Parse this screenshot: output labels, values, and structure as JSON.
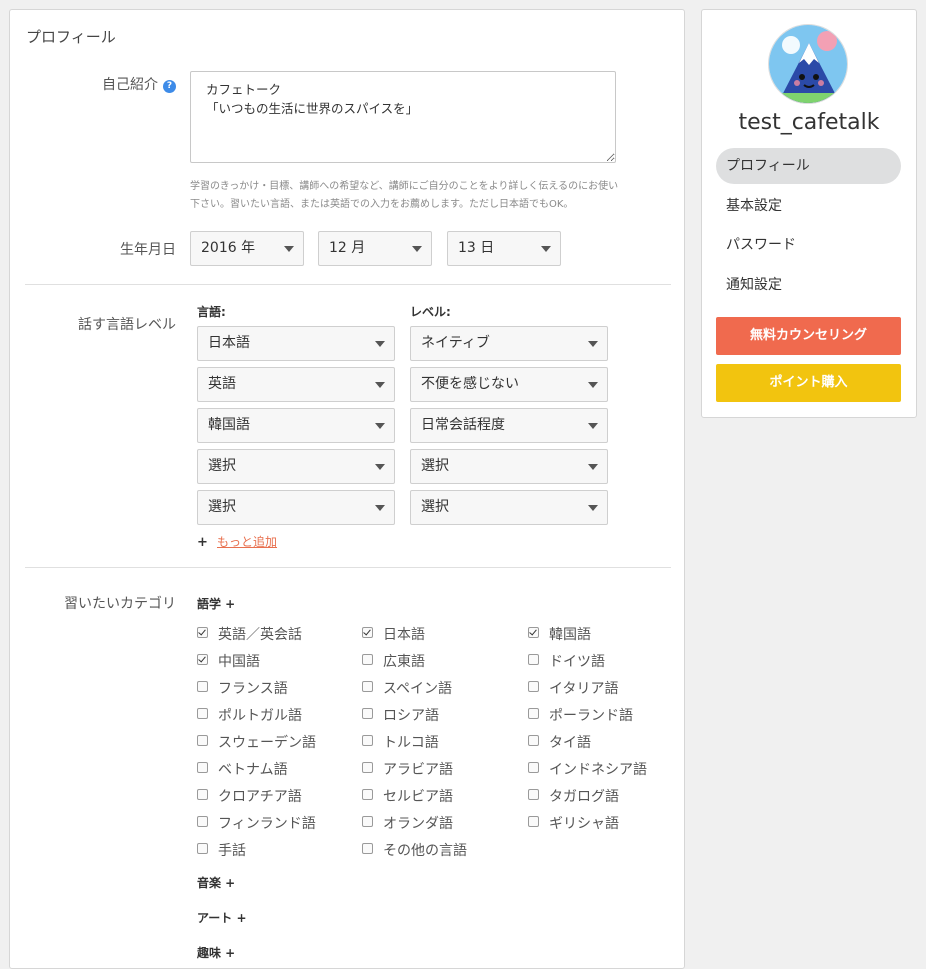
{
  "page_title": "プロフィール",
  "bio": {
    "label": "自己紹介",
    "value": "カフェトーク\n「いつもの生活に世界のスパイスを」",
    "hint": "学習のきっかけ・目標、講師への希望など、講師にご自分のことをより詳しく伝えるのにお使い下さい。習いたい言語、または英語での入力をお薦めします。ただし日本語でもOK。"
  },
  "birthday": {
    "label": "生年月日",
    "year": "2016 年",
    "month": "12 月",
    "day": "13 日"
  },
  "languages": {
    "label": "話す言語レベル",
    "col_language": "言語:",
    "col_level": "レベル:",
    "rows": [
      {
        "language": "日本語",
        "level": "ネイティブ"
      },
      {
        "language": "英語",
        "level": "不便を感じない"
      },
      {
        "language": "韓国語",
        "level": "日常会話程度"
      },
      {
        "language": "選択",
        "level": "選択"
      },
      {
        "language": "選択",
        "level": "選択"
      }
    ],
    "add_plus": "+",
    "add_more": "もっと追加"
  },
  "categories": {
    "label": "習いたいカテゴリ",
    "group_language": "語学 +",
    "items": [
      {
        "name": "英語／英会話",
        "checked": true
      },
      {
        "name": "日本語",
        "checked": true
      },
      {
        "name": "韓国語",
        "checked": true
      },
      {
        "name": "中国語",
        "checked": true
      },
      {
        "name": "広東語",
        "checked": false
      },
      {
        "name": "ドイツ語",
        "checked": false
      },
      {
        "name": "フランス語",
        "checked": false
      },
      {
        "name": "スペイン語",
        "checked": false
      },
      {
        "name": "イタリア語",
        "checked": false
      },
      {
        "name": "ポルトガル語",
        "checked": false
      },
      {
        "name": "ロシア語",
        "checked": false
      },
      {
        "name": "ポーランド語",
        "checked": false
      },
      {
        "name": "スウェーデン語",
        "checked": false
      },
      {
        "name": "トルコ語",
        "checked": false
      },
      {
        "name": "タイ語",
        "checked": false
      },
      {
        "name": "ベトナム語",
        "checked": false
      },
      {
        "name": "アラビア語",
        "checked": false
      },
      {
        "name": "インドネシア語",
        "checked": false
      },
      {
        "name": "クロアチア語",
        "checked": false
      },
      {
        "name": "セルビア語",
        "checked": false
      },
      {
        "name": "タガログ語",
        "checked": false
      },
      {
        "name": "フィンランド語",
        "checked": false
      },
      {
        "name": "オランダ語",
        "checked": false
      },
      {
        "name": "ギリシャ語",
        "checked": false
      },
      {
        "name": "手話",
        "checked": false
      },
      {
        "name": "その他の言語",
        "checked": false
      }
    ],
    "group_music": "音楽 +",
    "group_art": "アート +",
    "group_next": "趣味 +"
  },
  "sidebar": {
    "username": "test_cafetalk",
    "nav": [
      "プロフィール",
      "基本設定",
      "パスワード",
      "通知設定"
    ],
    "active_index": 0,
    "counseling_button": "無料カウンセリング",
    "points_button": "ポイント購入",
    "colors": {
      "counseling": "#f06a4e",
      "points": "#f2c40f"
    }
  }
}
